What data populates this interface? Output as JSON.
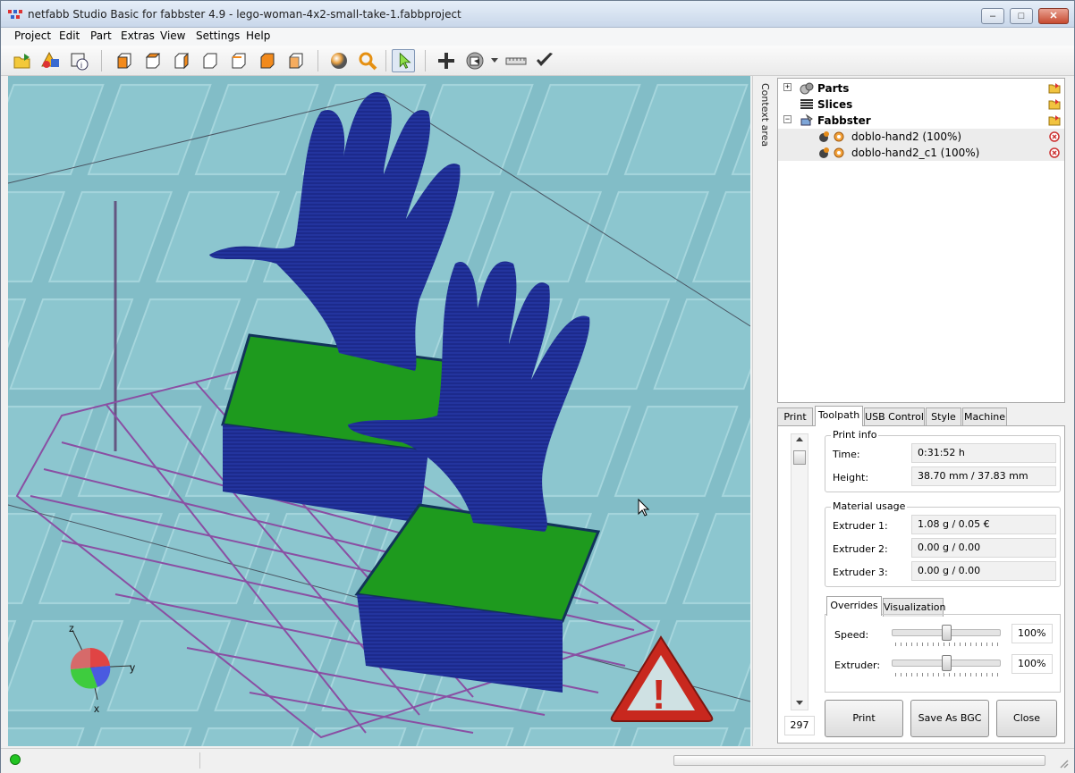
{
  "window": {
    "title": "netfabb Studio Basic for fabbster 4.9 - lego-woman-4x2-small-take-1.fabbproject",
    "minimize_label": "–",
    "maximize_label": "□",
    "close_label": "✕"
  },
  "menu": [
    "Project",
    "Edit",
    "Part",
    "Extras",
    "View",
    "Settings",
    "Help"
  ],
  "toolbar": {
    "icons": [
      "open-project-icon",
      "add-part-icon",
      "part-info-icon",
      "view-front-icon",
      "view-back-icon",
      "view-left-icon",
      "view-right-icon",
      "view-top-icon",
      "view-bottom-icon",
      "view-perspective-icon",
      "shading-icon",
      "zoom-icon",
      "select-tool-icon",
      "move-icon",
      "rotate-icon",
      "measure-icon",
      "repair-check-icon"
    ]
  },
  "viewport": {
    "axis_labels": {
      "z": "z",
      "y": "y",
      "x": "x"
    },
    "warning_glyph": "!"
  },
  "context_area_label": "Context area",
  "tree": {
    "expand_plus": "+",
    "expand_minus": "−",
    "items": [
      {
        "label": "Parts",
        "bold": true
      },
      {
        "label": "Slices",
        "bold": true
      },
      {
        "label": "Fabbster",
        "bold": true
      },
      {
        "label": "doblo-hand2 (100%)",
        "bold": false
      },
      {
        "label": "doblo-hand2_c1 (100%)",
        "bold": false
      }
    ]
  },
  "tabs": [
    "Print",
    "Toolpath",
    "USB Control",
    "Style",
    "Machine"
  ],
  "active_tab": "Toolpath",
  "layer_counter": "297",
  "print_info": {
    "title": "Print info",
    "time_label": "Time:",
    "time_value": "0:31:52 h",
    "height_label": "Height:",
    "height_value": "38.70 mm / 37.83 mm"
  },
  "material_usage": {
    "title": "Material usage",
    "rows": [
      {
        "label": "Extruder 1:",
        "value": "1.08 g / 0.05 €"
      },
      {
        "label": "Extruder 2:",
        "value": "0.00 g / 0.00"
      },
      {
        "label": "Extruder 3:",
        "value": "0.00 g / 0.00"
      }
    ]
  },
  "subtabs": [
    "Overrides",
    "Visualization"
  ],
  "overrides": {
    "speed_label": "Speed:",
    "speed_value": "100%",
    "speed_level": 0.5,
    "extruder_label": "Extruder:",
    "extruder_value": "100%",
    "extruder_level": 0.5
  },
  "buttons": {
    "print": "Print",
    "save_bgc": "Save As BGC",
    "close": "Close"
  },
  "colors": {
    "viewport_bg": "#82bdc7",
    "model_blue": "#1c2a8c",
    "model_green": "#1e9a1e",
    "platform_purple": "#8a4fa3",
    "warning_red": "#c8281e",
    "status_led": "#22c422"
  }
}
